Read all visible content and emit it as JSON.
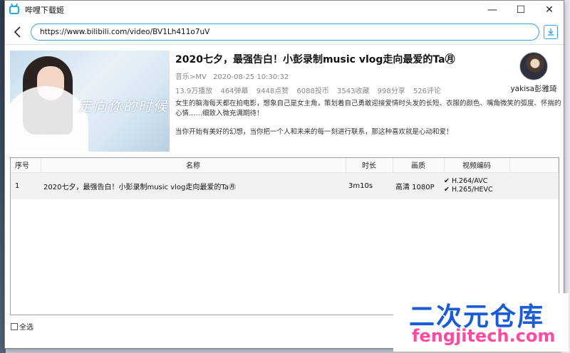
{
  "window": {
    "title": "哔哩下载姬",
    "minimize_glyph": "—",
    "maximize_glyph": "☐",
    "close_glyph": "✕"
  },
  "url_bar": {
    "value": "https://www.bilibili.com/video/BV1Lh411o7uV"
  },
  "video": {
    "cover_text": "走向你的时候",
    "title": "2020七夕，最强告白！小彭录制music vlog走向最爱的Ta㊊",
    "category": "音乐>MV",
    "date": "2020-08-25 10:30:32",
    "stats": [
      "13.9万播放",
      "464弹幕",
      "9448点赞",
      "6088投币",
      "3543收藏",
      "998分享",
      "526评论"
    ],
    "description": [
      "女生的脑海每天都在拍电影，想象自己是女主角，策划着自己勇敢迎接爱情时头发的长短、衣服的颜色、嘴角微笑的弧度、怀揣的心情……细致入微充满期待！",
      "当你开始有美好的幻想，当你把一个人和未来的每一刻进行联系，那这种喜欢就是心动和爱！"
    ],
    "uploader": "yakisa彭雅琦"
  },
  "table": {
    "headers": [
      "序号",
      "名称",
      "时长",
      "画质",
      "视频编码"
    ],
    "rows": [
      {
        "index": "1",
        "name": "2020七夕，最强告白！小彭录制music vlog走向最爱的Ta㊊",
        "duration": "3m10s",
        "quality": "高清 1080P",
        "codecs": [
          "H.264/AVC",
          "H.265/HEVC"
        ]
      }
    ]
  },
  "footer": {
    "select_all": "全选"
  },
  "watermark": {
    "title": "二次元仓库",
    "site": "fengjitech.com"
  }
}
